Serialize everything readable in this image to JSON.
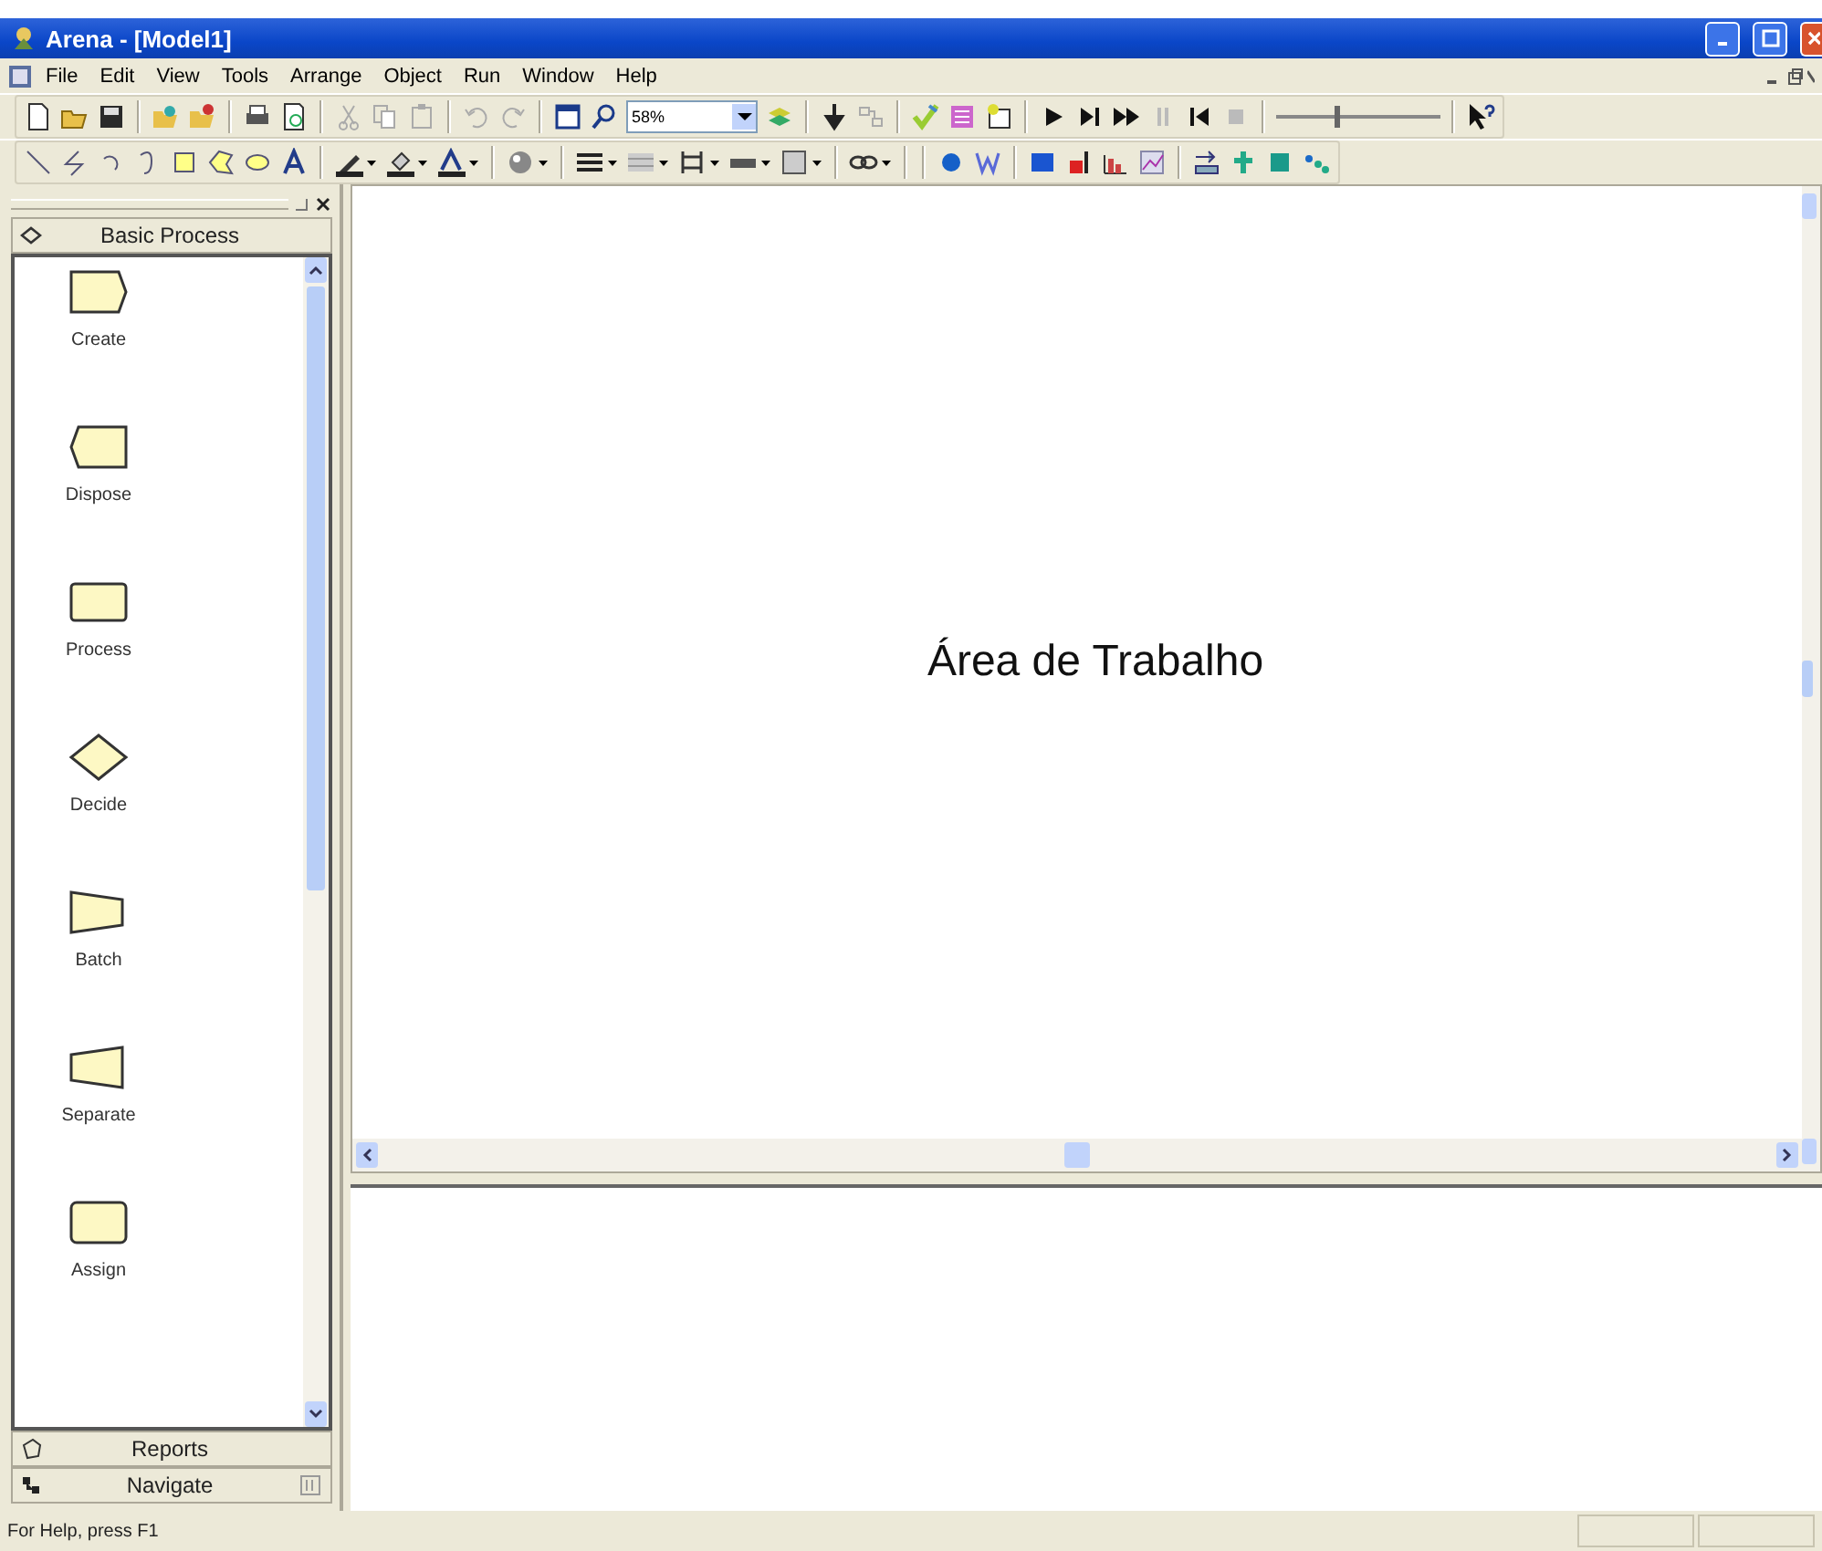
{
  "window": {
    "title": "Arena - [Model1]"
  },
  "menu": [
    {
      "label": "File"
    },
    {
      "label": "Edit"
    },
    {
      "label": "View"
    },
    {
      "label": "Tools"
    },
    {
      "label": "Arrange"
    },
    {
      "label": "Object"
    },
    {
      "label": "Run"
    },
    {
      "label": "Window"
    },
    {
      "label": "Help"
    }
  ],
  "toolbar": {
    "zoom": "58%",
    "speed_slider": {
      "level": 0.37
    }
  },
  "panel": {
    "sections": [
      {
        "title": "Basic Process",
        "expanded": true
      },
      {
        "title": "Reports",
        "expanded": false
      },
      {
        "title": "Navigate",
        "expanded": false
      }
    ],
    "modules": [
      {
        "label": "Create",
        "kind": "create"
      },
      {
        "label": "Dispose",
        "kind": "dispose"
      },
      {
        "label": "Process",
        "kind": "process"
      },
      {
        "label": "Decide",
        "kind": "decide"
      },
      {
        "label": "Batch",
        "kind": "batch"
      },
      {
        "label": "Separate",
        "kind": "separate"
      },
      {
        "label": "Assign",
        "kind": "assign"
      }
    ]
  },
  "canvas": {
    "label": "Área de Trabalho"
  },
  "status_bar": {
    "text": "For Help, press F1"
  }
}
